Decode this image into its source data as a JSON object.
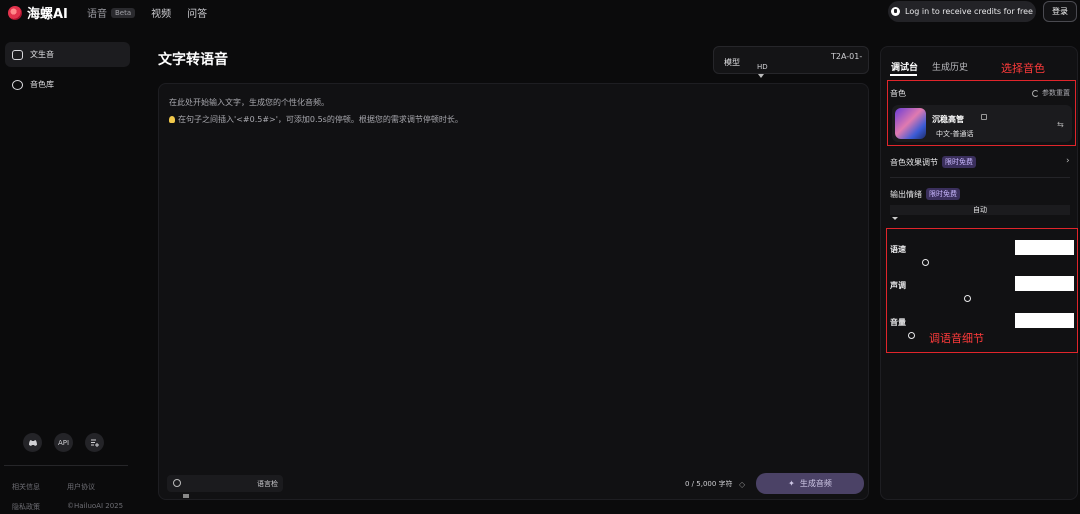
{
  "app": {
    "name": "海螺AI"
  },
  "topnav": [
    {
      "label": "语音",
      "badge": "Beta"
    },
    {
      "label": "视频"
    },
    {
      "label": "问答"
    }
  ],
  "header": {
    "credits_label": "Log in to receive credits for free",
    "login_label": "登录"
  },
  "sidebar": {
    "items": [
      {
        "label": "文生音",
        "icon": "text-to-speech-icon"
      },
      {
        "label": "音色库",
        "icon": "voice-library-icon"
      }
    ],
    "bottom_icons": [
      {
        "icon": "discord-icon"
      },
      {
        "label": "API"
      },
      {
        "icon": "feedback-icon"
      }
    ],
    "footer_links": [
      "相关信息",
      "用户协议",
      "隐私政策",
      "©HailuoAI 2025"
    ]
  },
  "main": {
    "title": "文字转语音",
    "model": {
      "label": "模型",
      "value": "T2A-01-",
      "sub": "HD"
    },
    "editor": {
      "placeholder_line1": "在此处开始输入文字，生成您的个性化音频。",
      "placeholder_line2": "在句子之间插入'<#0.5#>'，可添加0.5s的停顿。根据您的需求调节停顿时长。"
    },
    "language_label": "语言检",
    "char_count": "0 / 5,000 字符",
    "generate_label": "生成音频"
  },
  "panel": {
    "tabs": [
      "调试台",
      "生成历史"
    ],
    "annotation_top": "选择音色",
    "annotation_bottom": "调语音细节",
    "annotation_color": "#e0252b",
    "voice_label": "音色",
    "reset_label": "参数重置",
    "voice": {
      "name": "沉稳高管",
      "tag": "中文-普通话"
    },
    "effects_label": "音色效果调节",
    "free_badge": "限时免费",
    "emotion_label": "输出情绪",
    "emotion_value": "自动",
    "params": [
      {
        "label": "语速",
        "level": 0.26
      },
      {
        "label": "声调",
        "level": 0.72
      },
      {
        "label": "音量",
        "level": 0.1
      }
    ]
  }
}
